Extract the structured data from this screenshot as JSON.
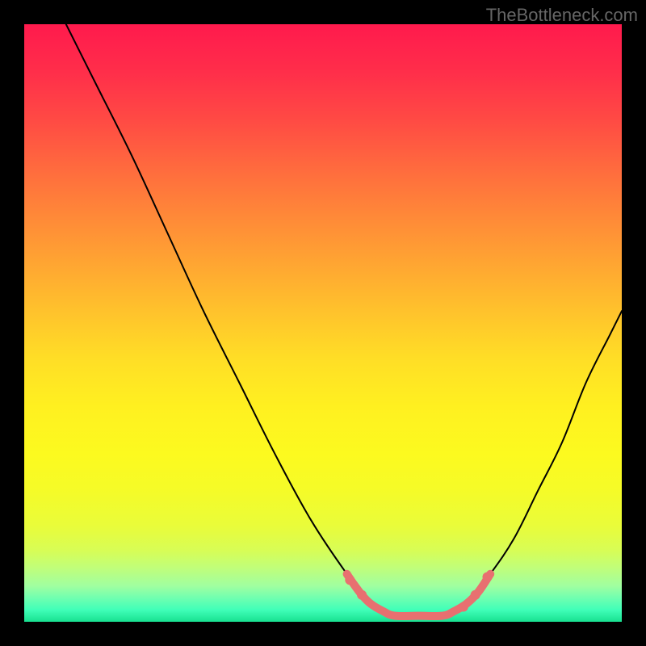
{
  "watermark": "TheBottleneck.com",
  "chart_data": {
    "type": "line",
    "title": "",
    "xlabel": "",
    "ylabel": "",
    "xlim": [
      0,
      100
    ],
    "ylim": [
      0,
      100
    ],
    "series": [
      {
        "name": "curve",
        "color": "#000000",
        "stroke_width": 2,
        "points": [
          {
            "x": 7,
            "y": 100
          },
          {
            "x": 12,
            "y": 90
          },
          {
            "x": 18,
            "y": 78
          },
          {
            "x": 24,
            "y": 65
          },
          {
            "x": 30,
            "y": 52
          },
          {
            "x": 36,
            "y": 40
          },
          {
            "x": 42,
            "y": 28
          },
          {
            "x": 48,
            "y": 17
          },
          {
            "x": 54,
            "y": 8
          },
          {
            "x": 58,
            "y": 3
          },
          {
            "x": 62,
            "y": 1
          },
          {
            "x": 66,
            "y": 1
          },
          {
            "x": 70,
            "y": 1
          },
          {
            "x": 74,
            "y": 3
          },
          {
            "x": 78,
            "y": 8
          },
          {
            "x": 82,
            "y": 14
          },
          {
            "x": 86,
            "y": 22
          },
          {
            "x": 90,
            "y": 30
          },
          {
            "x": 94,
            "y": 40
          },
          {
            "x": 98,
            "y": 48
          },
          {
            "x": 100,
            "y": 52
          }
        ]
      },
      {
        "name": "highlighted-bottom",
        "color": "#e87070",
        "stroke_width": 10,
        "points": [
          {
            "x": 54,
            "y": 8
          },
          {
            "x": 55,
            "y": 6.5
          },
          {
            "x": 56.5,
            "y": 4.5
          },
          {
            "x": 58,
            "y": 3
          },
          {
            "x": 60,
            "y": 1.8
          },
          {
            "x": 62,
            "y": 1
          },
          {
            "x": 66,
            "y": 1
          },
          {
            "x": 70,
            "y": 1
          },
          {
            "x": 72,
            "y": 1.8
          },
          {
            "x": 74,
            "y": 3
          },
          {
            "x": 76,
            "y": 5
          },
          {
            "x": 78,
            "y": 8
          }
        ]
      }
    ],
    "markers": [
      {
        "x": 54.5,
        "y": 7,
        "r": 6,
        "color": "#e87070"
      },
      {
        "x": 56.5,
        "y": 4.5,
        "r": 6,
        "color": "#e87070"
      },
      {
        "x": 73.5,
        "y": 2.5,
        "r": 6,
        "color": "#e87070"
      },
      {
        "x": 75.5,
        "y": 4.5,
        "r": 6,
        "color": "#e87070"
      },
      {
        "x": 77.5,
        "y": 7.5,
        "r": 6,
        "color": "#e87070"
      }
    ]
  }
}
